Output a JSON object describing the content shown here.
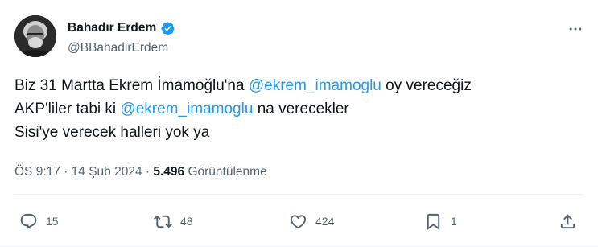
{
  "author": {
    "display_name": "Bahadır Erdem",
    "handle": "@BBahadirErdem",
    "verified": true
  },
  "tweet": {
    "line1": {
      "before": "Biz 31 Martta Ekrem İmamoğlu'na ",
      "mention": "@ekrem_imamoglu",
      "after": " oy vereceğiz"
    },
    "line2": {
      "before": "AKP'liler tabi ki ",
      "mention": "@ekrem_imamoglu",
      "after": " na verecekler"
    },
    "line3": "Sisi'ye verecek halleri yok ya"
  },
  "meta": {
    "time": "ÖS 9:17",
    "separator": "·",
    "date": "14 Şub 2024",
    "views_count": "5.496",
    "views_label": "Görüntülenme"
  },
  "actions": {
    "replies": "15",
    "reposts": "48",
    "likes": "424",
    "bookmarks": "1"
  },
  "colors": {
    "accent": "#1d9bf0",
    "text": "#0f1419",
    "secondary": "#536471"
  },
  "icons": [
    "verified-badge-icon",
    "more-icon",
    "reply-icon",
    "repost-icon",
    "like-icon",
    "bookmark-icon",
    "share-icon"
  ]
}
